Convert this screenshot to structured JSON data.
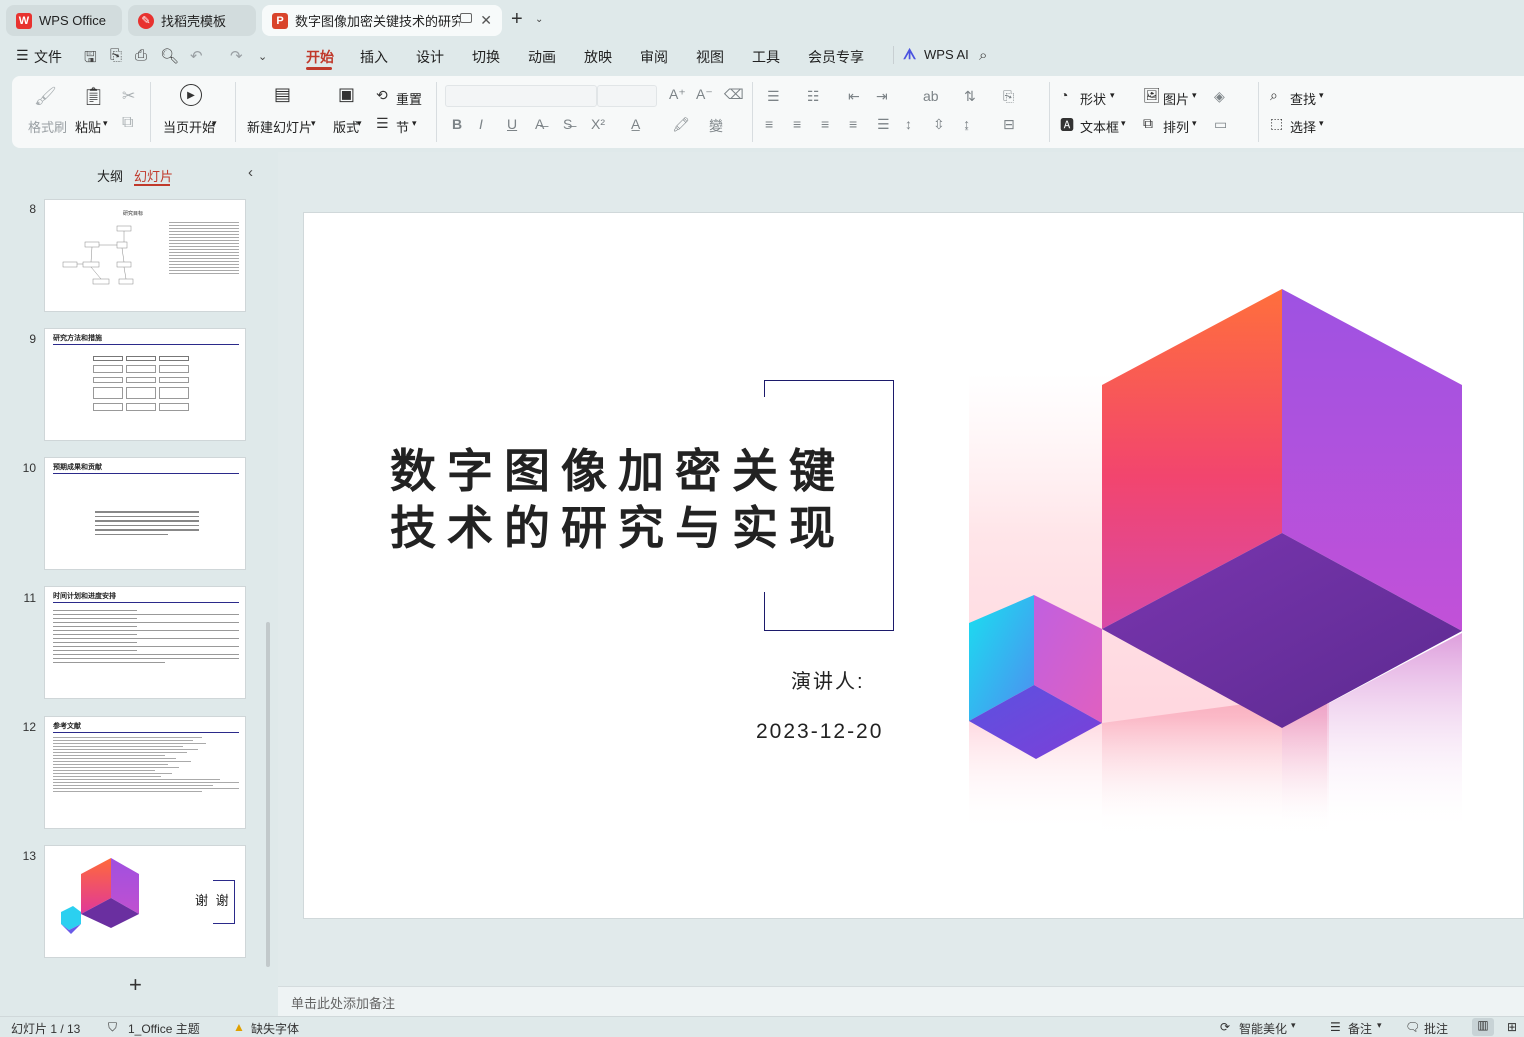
{
  "tabs": [
    {
      "label": "WPS Office"
    },
    {
      "label": "找稻壳模板"
    },
    {
      "label": "数字图像加密关键技术的研究与"
    }
  ],
  "menu": {
    "file": "文件",
    "items": [
      "开始",
      "插入",
      "设计",
      "切换",
      "动画",
      "放映",
      "审阅",
      "视图",
      "工具",
      "会员专享"
    ],
    "ai": "WPS AI"
  },
  "ribbon": {
    "format_painter": "格式刷",
    "paste": "粘贴",
    "play_from_current": "当页开始",
    "new_slide": "新建幻灯片",
    "layout": "版式",
    "reset": "重置",
    "section": "节",
    "shape": "形状",
    "picture": "图片",
    "textbox": "文本框",
    "arrange": "排列",
    "find": "查找",
    "select": "选择"
  },
  "panel": {
    "outline_tab": "大纲",
    "slides_tab": "幻灯片",
    "thumbs": [
      {
        "num": "8",
        "title": "研究目标"
      },
      {
        "num": "9",
        "title": "研究方法和措施"
      },
      {
        "num": "10",
        "title": "预期成果和贡献"
      },
      {
        "num": "11",
        "title": "时间计划和进度安排"
      },
      {
        "num": "12",
        "title": "参考文献"
      },
      {
        "num": "13",
        "title": "谢 谢"
      }
    ],
    "add": "+"
  },
  "slide": {
    "title_line1": "数字图像加密关键",
    "title_line2": "技术的研究与实现",
    "presenter": "演讲人:",
    "date": "2023-12-20"
  },
  "notes_placeholder": "单击此处添加备注",
  "status": {
    "slide_count": "幻灯片 1 / 13",
    "theme": "1_Office 主题",
    "missing_font": "缺失字体",
    "beautify": "智能美化",
    "notes": "备注",
    "comments": "批注"
  },
  "colors": {
    "accent": "#c0392b",
    "title_frame": "#1c1a6b",
    "cube_orange": "#ff6f3c",
    "cube_purple": "#9b4fe0",
    "cube_cyan": "#19e0f0"
  }
}
